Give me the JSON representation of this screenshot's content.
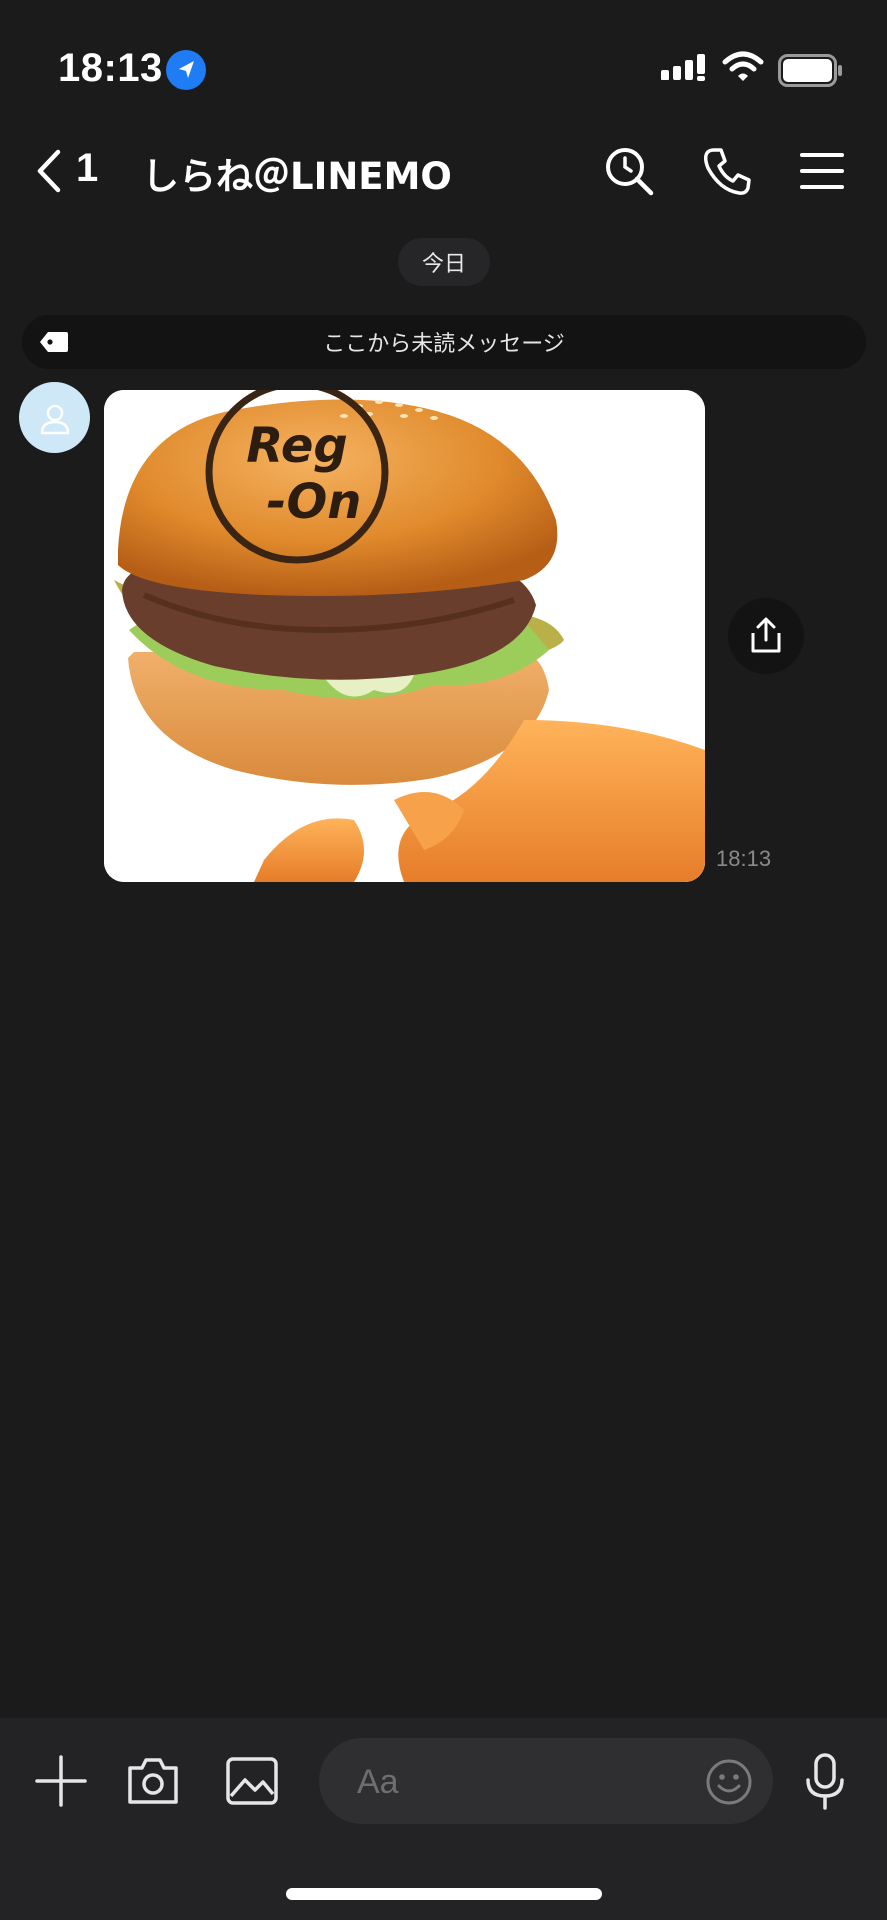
{
  "status_bar": {
    "time": "18:13"
  },
  "header": {
    "back_count": "1",
    "title": "しらね＠LINEMO"
  },
  "chat": {
    "date_label": "今日",
    "unread_banner": "ここから未読メッセージ",
    "messages": [
      {
        "type": "image",
        "image_text": "Reg-On",
        "time": "18:13"
      }
    ]
  },
  "input_bar": {
    "placeholder": "Aa"
  },
  "colors": {
    "background": "#1b1b1c",
    "avatar_bg": "#cfe8f8",
    "location_blue": "#1f7cf5"
  },
  "icons": [
    "location-arrow-icon",
    "signal-icon",
    "wifi-icon",
    "battery-icon",
    "back-chevron-icon",
    "search-icon",
    "phone-icon",
    "menu-icon",
    "tag-icon",
    "person-icon",
    "share-icon",
    "plus-icon",
    "camera-icon",
    "image-icon",
    "emoji-icon",
    "microphone-icon"
  ]
}
